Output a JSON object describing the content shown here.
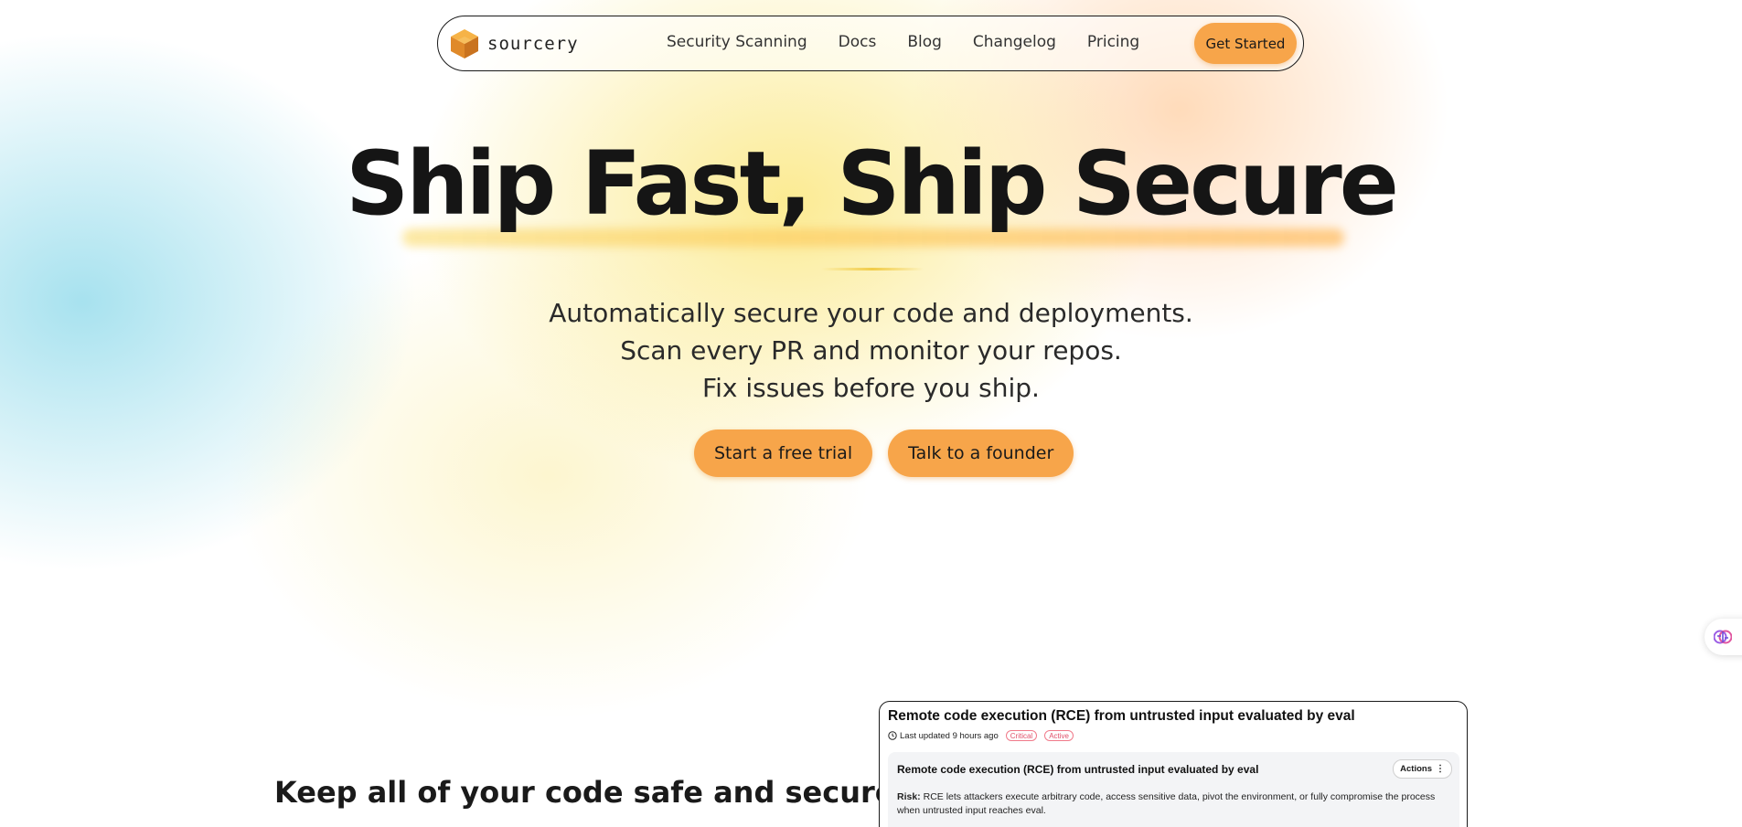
{
  "nav": {
    "brand": "sourcery",
    "links": [
      "Security Scanning",
      "Docs",
      "Blog",
      "Changelog",
      "Pricing"
    ],
    "cta": "Get Started"
  },
  "hero": {
    "title": "Ship Fast, Ship Secure",
    "subtitle_lines": [
      "Automatically secure your code and deployments.",
      "Scan every PR and monitor your repos.",
      "Fix issues before you ship."
    ],
    "cta_primary": "Start a free trial",
    "cta_secondary": "Talk to a founder"
  },
  "section2": {
    "heading": "Keep all of your code safe and secure."
  },
  "issue_card": {
    "title": "Remote code execution (RCE) from untrusted input evaluated by eval",
    "updated": "Last updated 9 hours ago",
    "badges": [
      "Critical",
      "Active"
    ],
    "inner_title": "Remote code execution (RCE) from untrusted input evaluated by eval",
    "actions_label": "Actions",
    "risk_label": "Risk:",
    "risk_text": "RCE lets attackers execute arbitrary code, access sensitive data, pivot the environment, or fully compromise the process when untrusted input reaches eval."
  },
  "colors": {
    "accent": "#f7a54a",
    "badge": "#e0506a"
  },
  "icons": {
    "logo": "sourcery-cube-icon",
    "floating": "brain-icon",
    "clock": "clock-icon",
    "kebab": "kebab-menu-icon"
  }
}
